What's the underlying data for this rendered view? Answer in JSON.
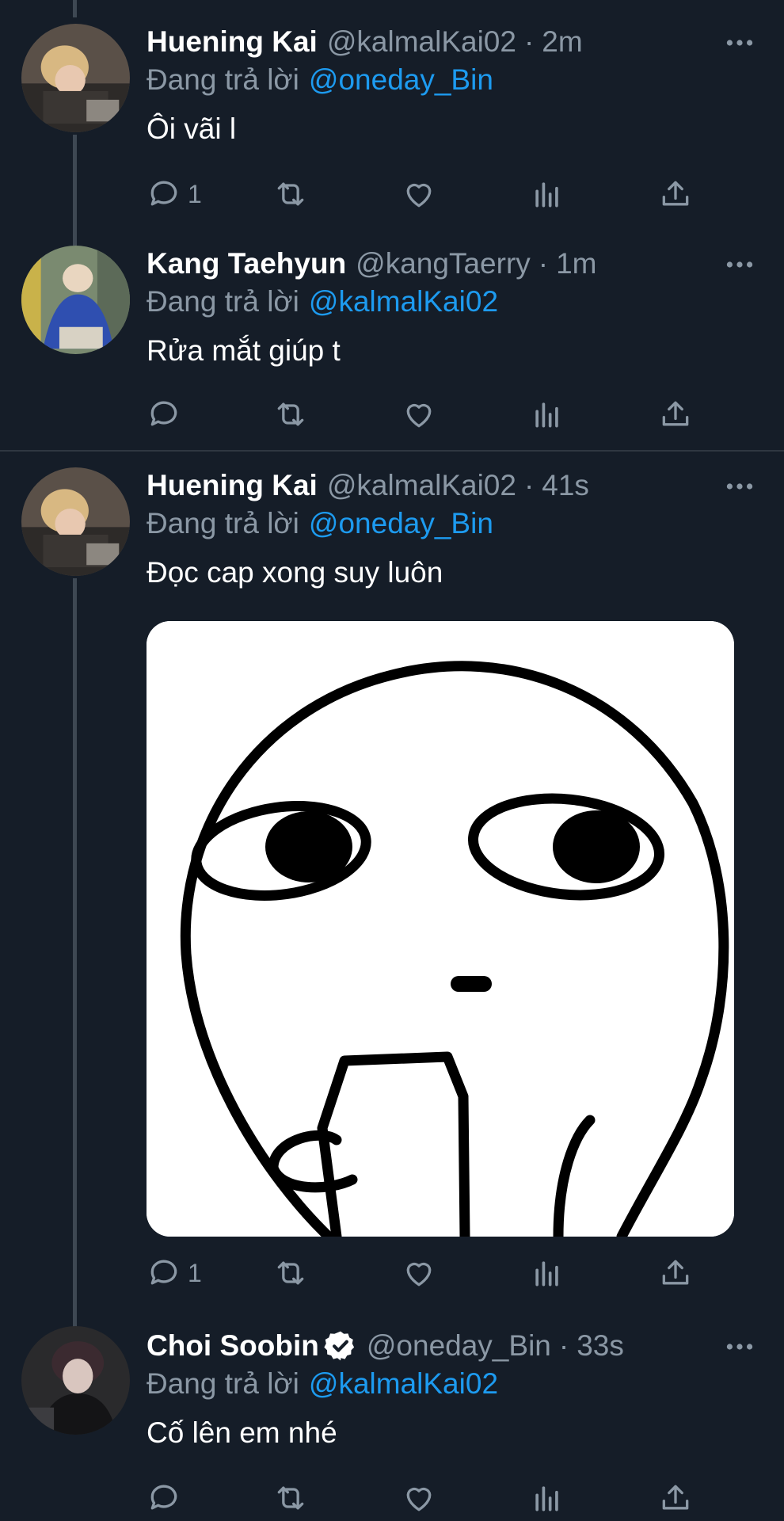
{
  "tweets": [
    {
      "name": "Huening Kai",
      "handle": "@kalmalKai02",
      "separator": "·",
      "time": "2m",
      "reply_prefix": "Đang trả lời",
      "reply_to": "@oneday_Bin",
      "text": "Ôi vãi l",
      "reply_count": "1",
      "avatar": "huening-kai-avatar"
    },
    {
      "name": "Kang Taehyun",
      "handle": "@kangTaerry",
      "separator": "·",
      "time": "1m",
      "reply_prefix": "Đang trả lời",
      "reply_to": "@kalmalKai02",
      "text": "Rửa mắt giúp t",
      "reply_count": "",
      "avatar": "kang-taehyun-avatar"
    },
    {
      "name": "Huening Kai",
      "handle": "@kalmalKai02",
      "separator": "·",
      "time": "41s",
      "reply_prefix": "Đang trả lời",
      "reply_to": "@oneday_Bin",
      "text": "Đọc cap xong suy luôn",
      "reply_count": "1",
      "avatar": "huening-kai-avatar",
      "media": "meme-face-image"
    },
    {
      "name": "Choi Soobin",
      "verified": true,
      "handle": "@oneday_Bin",
      "separator": "·",
      "time": "33s",
      "reply_prefix": "Đang trả lời",
      "reply_to": "@kalmalKai02",
      "text": "Cố lên em nhé",
      "reply_count": "",
      "avatar": "choi-soobin-avatar"
    }
  ],
  "colors": {
    "background": "#151d28",
    "text": "#ffffff",
    "secondary": "#8b98a5",
    "link": "#1d9bf0",
    "thread_line": "#3e4853",
    "divider": "#2f3741"
  },
  "icons": {
    "more": "more-horizontal-icon",
    "reply": "reply-icon",
    "retweet": "retweet-icon",
    "like": "heart-icon",
    "views": "views-icon",
    "share": "share-icon",
    "verified": "verified-badge-icon"
  }
}
